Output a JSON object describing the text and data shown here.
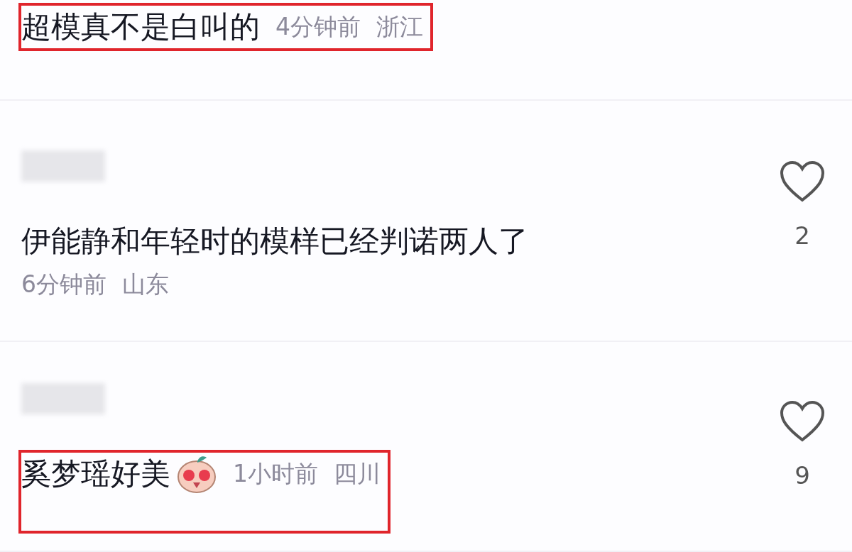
{
  "comments": [
    {
      "kind": "inline",
      "username_hidden": false,
      "highlighted": true,
      "text": "超模真不是白叫的",
      "emoji": false,
      "time": "4分钟前",
      "location": "浙江"
    },
    {
      "kind": "stacked",
      "username_hidden": true,
      "highlighted": false,
      "text": "伊能静和年轻时的模样已经判诺两人了",
      "emoji": false,
      "time": "6分钟前",
      "location": "山东",
      "likes": "2"
    },
    {
      "kind": "inline",
      "username_hidden": true,
      "highlighted": true,
      "text": "奚梦瑶好美",
      "emoji": true,
      "time": "1小时前",
      "location": "四川",
      "likes": "9"
    }
  ]
}
